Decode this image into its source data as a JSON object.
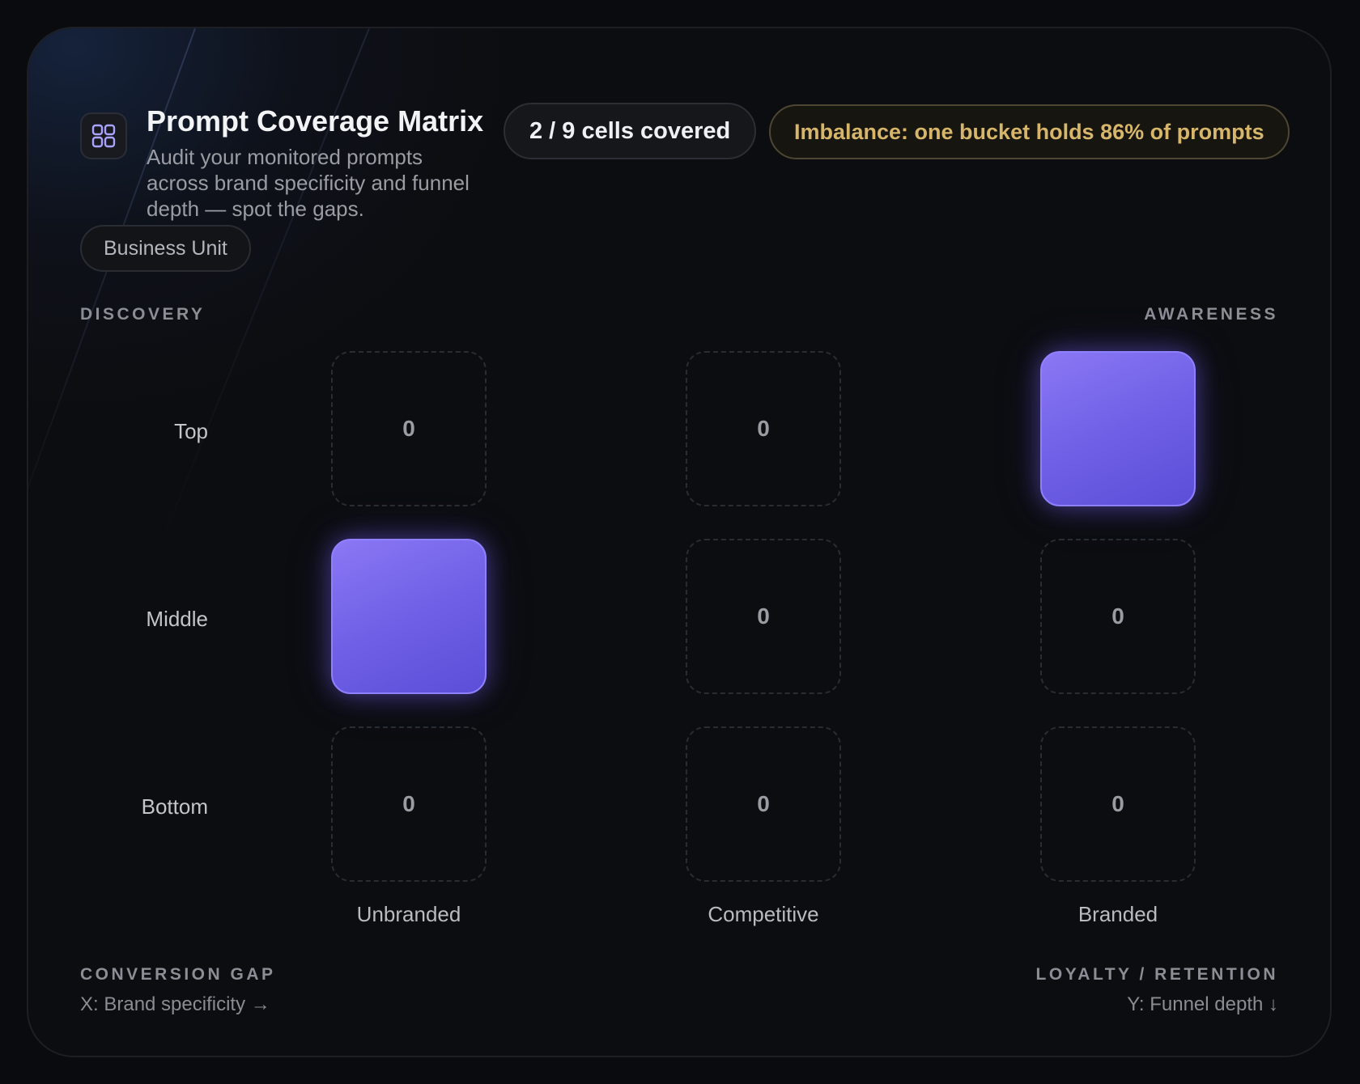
{
  "header": {
    "title": "Prompt Coverage Matrix",
    "subtitle": "Audit your monitored prompts across brand specificity and funnel depth — spot the gaps.",
    "icon": "grid-icon"
  },
  "badges": {
    "covered": "2 / 9 cells covered",
    "imbalance": "Imbalance: one bucket holds 86% of prompts"
  },
  "filter": {
    "business_unit_label": "Business Unit"
  },
  "quadrants": {
    "top_left": "DISCOVERY",
    "top_right": "AWARENESS",
    "bottom_left": "CONVERSION GAP",
    "bottom_right": "LOYALTY / RETENTION"
  },
  "axes": {
    "x_caption": "X: Brand specificity →",
    "y_caption": "Y: Funnel depth ↓"
  },
  "rows": [
    "Top",
    "Middle",
    "Bottom"
  ],
  "columns": [
    "Unbranded",
    "Competitive",
    "Branded"
  ],
  "cells": [
    [
      {
        "value": "0",
        "filled": false
      },
      {
        "value": "0",
        "filled": false
      },
      {
        "value": "",
        "filled": true
      }
    ],
    [
      {
        "value": "",
        "filled": true
      },
      {
        "value": "0",
        "filled": false
      },
      {
        "value": "0",
        "filled": false
      }
    ],
    [
      {
        "value": "0",
        "filled": false
      },
      {
        "value": "0",
        "filled": false
      },
      {
        "value": "0",
        "filled": false
      }
    ]
  ],
  "colors": {
    "accent": "#6f60e6",
    "warning": "#d7b66a",
    "background": "#0c0d10"
  }
}
